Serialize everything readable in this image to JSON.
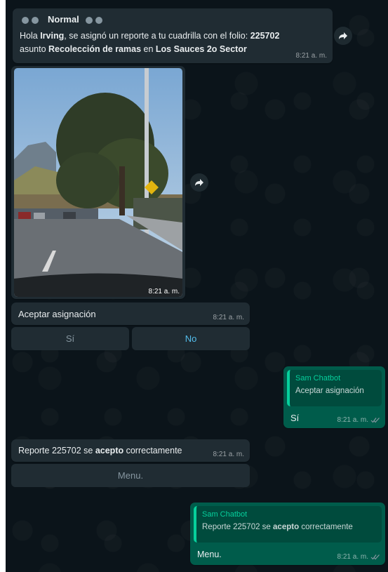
{
  "msg1": {
    "priority": "Normal",
    "greeting": "Hola",
    "name": "Irving",
    "text_a": ", se asignó un reporte a tu cuadrilla con el folio:",
    "folio": "225702",
    "text_b": "asunto",
    "subject": "Recolección de ramas",
    "text_c": "en",
    "location": "Los Sauces 2o Sector",
    "time": "8:21 a. m."
  },
  "photo": {
    "time": "8:21 a. m."
  },
  "msg2": {
    "text": "Aceptar asignación",
    "time": "8:21 a. m."
  },
  "buttons1": {
    "yes": "Sí",
    "no": "No"
  },
  "reply1": {
    "author": "Sam Chatbot",
    "quoted": "Aceptar asignación",
    "text": "Sí",
    "time": "8:21 a. m."
  },
  "msg3": {
    "text_a": "Reporte 225702 se",
    "bold": "acepto",
    "text_b": "correctamente",
    "time": "8:21 a. m."
  },
  "buttons2": {
    "menu": "Menu."
  },
  "reply2": {
    "author": "Sam Chatbot",
    "quoted_a": "Reporte 225702 se",
    "quoted_bold": "acepto",
    "quoted_b": "correctamente",
    "text": "Menu.",
    "time": "8:21 a. m."
  },
  "colors": {
    "background": "#0b141a",
    "incoming": "#202c33",
    "outgoing": "#005c4b",
    "accent": "#06cf9c",
    "link_button": "#53bdeb"
  }
}
